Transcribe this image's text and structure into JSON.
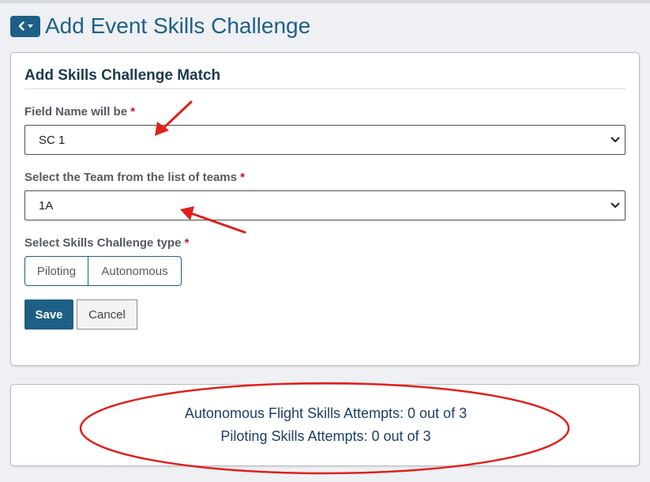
{
  "header": {
    "title": "Add Event Skills Challenge",
    "back_icon": "chevron-left-icon",
    "dropdown_icon": "caret-down-icon"
  },
  "form": {
    "title": "Add Skills Challenge Match",
    "field_name": {
      "label": "Field Name will be",
      "required_mark": "*",
      "value": "SC 1"
    },
    "team": {
      "label": "Select the Team from the list of teams",
      "required_mark": "*",
      "value": "1A"
    },
    "challenge_type": {
      "label": "Select Skills Challenge type",
      "required_mark": "*",
      "options": [
        "Piloting",
        "Autonomous"
      ]
    },
    "save_label": "Save",
    "cancel_label": "Cancel"
  },
  "attempts": {
    "autonomous": "Autonomous Flight Skills Attempts: 0 out of 3",
    "piloting": "Piloting Skills Attempts: 0 out of 3"
  },
  "colors": {
    "primary": "#1e5f86",
    "title": "#1e5f86",
    "required": "#c8102e",
    "annotation": "#e0201b",
    "attempt_text": "#1e3f66"
  }
}
